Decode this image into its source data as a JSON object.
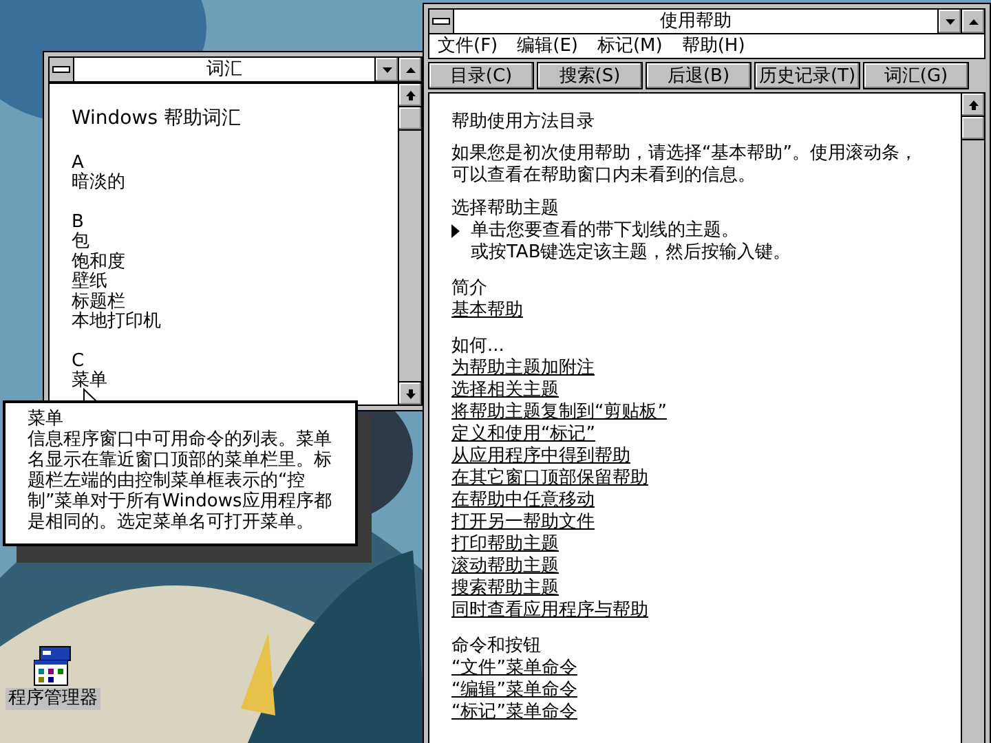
{
  "desktop": {
    "icons": [
      {
        "label": "程序管理器"
      }
    ]
  },
  "glossary_window": {
    "title": "词汇",
    "heading": "Windows 帮助词汇",
    "sections": [
      {
        "letter": "A",
        "terms": [
          "暗淡的"
        ]
      },
      {
        "letter": "B",
        "terms": [
          "包",
          "饱和度",
          "壁纸",
          "标题栏",
          "本地打印机"
        ]
      },
      {
        "letter": "C",
        "terms": [
          "菜单"
        ]
      }
    ]
  },
  "popup": {
    "term": "菜单",
    "definition": "信息程序窗口中可用命令的列表。菜单名显示在靠近窗口顶部的菜单栏里。标题栏左端的由控制菜单框表示的“控制”菜单对于所有Windows应用程序都是相同的。选定菜单名可打开菜单。"
  },
  "help_window": {
    "title": "使用帮助",
    "menu": [
      "文件(F)",
      "编辑(E)",
      "标记(M)",
      "帮助(H)"
    ],
    "buttons": [
      "目录(C)",
      "搜索(S)",
      "后退(B)",
      "历史记录(T)",
      "词汇(G)"
    ],
    "content": {
      "title": "帮助使用方法目录",
      "intro": "如果您是初次使用帮助，请选择“基本帮助”。使用滚动条，可以查看在帮助窗口内未看到的信息。",
      "choose_heading": "选择帮助主题",
      "choose_lines": [
        "单击您要查看的带下划线的主题。",
        "或按TAB键选定该主题，然后按输入键。"
      ],
      "groups": [
        {
          "heading": "简介",
          "links": [
            "基本帮助"
          ]
        },
        {
          "heading": "如何...",
          "links": [
            "为帮助主题加附注",
            "选择相关主题",
            "将帮助主题复制到“剪贴板”",
            "定义和使用“标记”",
            "从应用程序中得到帮助",
            "在其它窗口顶部保留帮助",
            "在帮助中任意移动",
            "打开另一帮助文件",
            "打印帮助主题",
            "滚动帮助主题",
            "搜索帮助主题",
            "同时查看应用程序与帮助"
          ]
        },
        {
          "heading": "命令和按钮",
          "links": [
            "“文件”菜单命令",
            "“编辑”菜单命令",
            "“标记”菜单命令"
          ]
        }
      ]
    }
  }
}
